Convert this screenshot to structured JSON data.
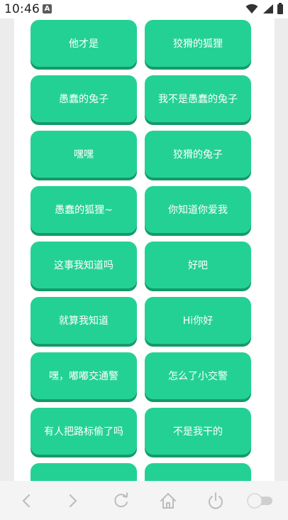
{
  "status_bar": {
    "time": "10:46",
    "notification_icon": "A"
  },
  "phrases": [
    "他才是",
    "狡猾的狐狸",
    "愚蠢的兔子",
    "我不是愚蠢的兔子",
    "嘿嘿",
    "狡猾的兔子",
    "愚蠢的狐狸~",
    "你知道你爱我",
    "这事我知道吗",
    "好吧",
    "就算我知道",
    "Hi你好",
    "嘿，嘟嘟交通警",
    "怎么了小交警",
    "有人把路标偷了吗",
    "不是我干的",
    "",
    ""
  ],
  "colors": {
    "button_fill": "#24d195",
    "button_shadow": "#159a6a",
    "nav_icon": "#bdbdbd"
  },
  "nav_icons": [
    "back-icon",
    "forward-icon",
    "refresh-icon",
    "home-icon",
    "power-icon",
    "toggle-switch-icon"
  ]
}
